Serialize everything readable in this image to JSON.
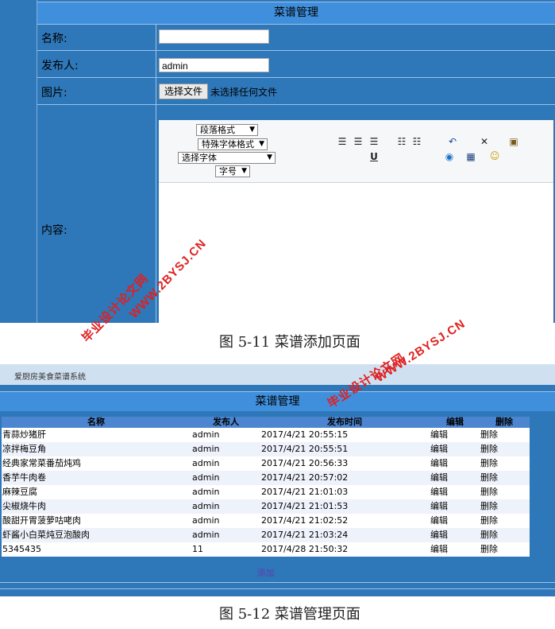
{
  "top_form": {
    "title": "菜谱管理",
    "name_label": "名称:",
    "name_value": "",
    "publisher_label": "发布人:",
    "publisher_value": "admin",
    "image_label": "图片:",
    "file_button": "选择文件",
    "file_status": "未选择任何文件",
    "content_label": "内容:",
    "editor": {
      "paragraph_format": "段落格式",
      "special_format": "特殊字体格式",
      "font_select": "选择字体",
      "font_size": "字号"
    }
  },
  "captions": {
    "fig11": "图 5-11 菜谱添加页面",
    "fig12": "图 5-12 菜谱管理页面"
  },
  "watermarks": {
    "site": "毕业设计论文网",
    "url": "WWW.2BYSJ.CN"
  },
  "bottom_strip_text": "爱厨房美食菜谱系统",
  "manage": {
    "title": "菜谱管理",
    "headers": [
      "名称",
      "发布人",
      "发布时间",
      "编辑",
      "删除"
    ],
    "rows": [
      {
        "name": "青蒜炒猪肝",
        "publisher": "admin",
        "time": "2017/4/21 20:55:15",
        "edit": "编辑",
        "delete": "删除"
      },
      {
        "name": "凉拌梅豆角",
        "publisher": "admin",
        "time": "2017/4/21 20:55:51",
        "edit": "编辑",
        "delete": "删除"
      },
      {
        "name": "经典家常菜番茄炖鸡",
        "publisher": "admin",
        "time": "2017/4/21 20:56:33",
        "edit": "编辑",
        "delete": "删除"
      },
      {
        "name": "香芋牛肉卷",
        "publisher": "admin",
        "time": "2017/4/21 20:57:02",
        "edit": "编辑",
        "delete": "删除"
      },
      {
        "name": "麻辣豆腐",
        "publisher": "admin",
        "time": "2017/4/21 21:01:03",
        "edit": "编辑",
        "delete": "删除"
      },
      {
        "name": "尖椒烧牛肉",
        "publisher": "admin",
        "time": "2017/4/21 21:01:53",
        "edit": "编辑",
        "delete": "删除"
      },
      {
        "name": "酸甜开胃菠萝咕咾肉",
        "publisher": "admin",
        "time": "2017/4/21 21:02:52",
        "edit": "编辑",
        "delete": "删除"
      },
      {
        "name": "虾酱小白菜炖豆泡酸肉",
        "publisher": "admin",
        "time": "2017/4/21 21:03:24",
        "edit": "编辑",
        "delete": "删除"
      },
      {
        "name": "5345435",
        "publisher": "11",
        "time": "2017/4/28 21:50:32",
        "edit": "编辑",
        "delete": "删除"
      }
    ],
    "add_link": "添加"
  },
  "colors": {
    "panel": "#2e77b8",
    "title_bar": "#3f8fdc",
    "header": "#4c86d0",
    "row_alt": "#eef2fb",
    "watermark": "#e02020"
  }
}
